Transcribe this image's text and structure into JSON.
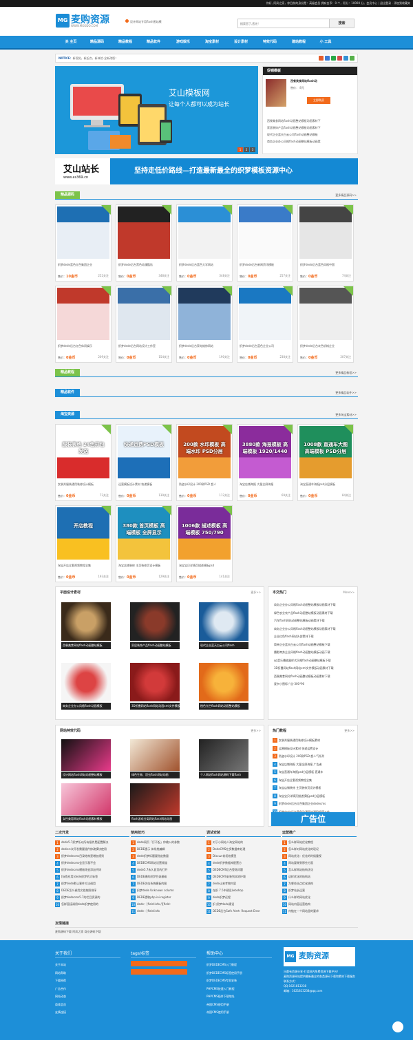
{
  "topbar": {
    "text": "你好, 阿凤之家，你目前的身份是：高级会员 拥有金币：0 个，积分：10000 分。会员中心 | 退出登录 · 添加到收藏夹"
  },
  "header": {
    "logo_mark": "MG",
    "logo_name": "麦购资源",
    "logo_url": "WWW.MGODO.COM",
    "slogan": "设计网站专用flash图站模",
    "search_placeholder": "搜索您了,您先!",
    "search_button": "搜索"
  },
  "nav": [
    "关 主页",
    "精品源码",
    "精品教程",
    "精品软件",
    "游戏娱乐",
    "淘宝素材",
    "设计素材",
    "特效代码",
    "建站教程",
    "小 工具"
  ],
  "notice": {
    "label": "NOTICE：",
    "text": "新视觉，新起点，新体验-全新改版！"
  },
  "banner": {
    "title": "艾山模板网",
    "subtitle": "让每个人都可以成为站长",
    "slides": [
      "1",
      "2",
      "3"
    ]
  },
  "promo": {
    "header": "促销模板",
    "title": "西餐美食网站flash动",
    "price": "售价：  8元",
    "buy": "立即购买",
    "items": [
      "西餐美食网站flash动画整站模板动画素材下",
      "家居装饰产品flash动画整站模板动画素材下",
      "现代企业蓝天白云公司flash动画整站模板",
      "商务企业办公风格flash动画整站模板动画素"
    ]
  },
  "ad": {
    "name": "艾山站长",
    "url": "www.as369.cn",
    "slogan": "坚持走低价路线—打造最新最全的织梦模板资源中心"
  },
  "sections": {
    "source": {
      "tag": "精品源码",
      "more": "更多精品源码>>"
    },
    "tutorial": {
      "tag": "精品教程",
      "more": "更多精品教程>>"
    },
    "software": {
      "tag": "精品软件",
      "more": "更多精品软件>>"
    },
    "taobao": {
      "tag": "淘宝资源",
      "more": "更多淘宝素材>>"
    }
  },
  "source_cards": [
    {
      "cap": "织梦dede蓝色红色集团企业",
      "price": "10金币",
      "fo": "252关注"
    },
    {
      "cap": "织梦dede后台黑色动漫酷炫",
      "price": "0金币",
      "fo": "348关注"
    },
    {
      "cap": "织梦dede后台蓝色大学网站",
      "price": "0金币",
      "fo": "348关注"
    },
    {
      "cap": "织梦dede后台新闻资讯模板",
      "price": "0金币",
      "fo": "257关注"
    },
    {
      "cap": "织梦dede后台蓝色风格中国",
      "price": "0金币",
      "fo": "74关注"
    },
    {
      "cap": "织梦dede后台红色休闲娱乐",
      "price": "0金币",
      "fo": "209关注"
    },
    {
      "cap": "织梦dede后台网站设计工作室",
      "price": "0金币",
      "fo": "154关注"
    },
    {
      "cap": "织梦dede后台家电维修网站",
      "price": "0金币",
      "fo": "190关注"
    },
    {
      "cap": "织梦dede后台蓝色企业公司",
      "price": "0金币",
      "fo": "238关注"
    },
    {
      "cap": "织梦dede后台灰色机械企业",
      "price": "0金币",
      "fo": "207关注"
    }
  ],
  "taobao_cards": [
    {
      "cap": "女装秀服装通用装修设计模板",
      "price": "0金币",
      "fo": "72关注",
      "label": "服装表格 24色打包发送"
    },
    {
      "cap": "运营模板设计素材 快递模板",
      "price": "0金币",
      "fo": "139关注",
      "label": "快递运费PSD模板"
    },
    {
      "cap": "防盗水印设计 200款PSD 超人",
      "price": "0金币",
      "fo": "112关注",
      "label": "200款 水印模板 高端水印 PSD分层"
    },
    {
      "cap": "淘宝店铺海报 大量全屏海报",
      "price": "0金币",
      "fo": "69关注",
      "label": "3880款 海报模板 高端模板 1920/1440"
    },
    {
      "cap": "淘宝直通车海报psd分层模板",
      "price": "0金币",
      "fo": "84关注",
      "label": "1008款 直通车大图 高端模板 PSD分层"
    },
    {
      "cap": "淘宝开店全套视频教程全集",
      "price": "0金币",
      "fo": "193关注",
      "label": "开店教程"
    },
    {
      "cap": "淘宝店铺装修 主页装修页设计模板",
      "price": "0金币",
      "fo": "129关注",
      "label": "380款 首页模板 高端模板 全屏显示"
    },
    {
      "cap": "淘宝宝贝详情页描述模板psd",
      "price": "0金币",
      "fo": "141关注",
      "label": "1006款 描述模板 高端模板 750/790"
    }
  ],
  "design_box": {
    "title": "平面设计素材",
    "more": "更多>>",
    "items": [
      "西餐美食网站flash动画整站模板",
      "家居装饰产品flash动画整站模板",
      "现代企业蓝天白云公司flash",
      "商务企业办公风格flash动画模板",
      "3D折叠网站flash网站动画xml文件模板",
      "橙色光芒flash网站动画整站模板"
    ]
  },
  "hot_box": {
    "title": "本交热门",
    "more": "More>>",
    "items": [
      "商务企业办公风格flash动画整站模板动画素材下载",
      "绿色农业农产品flash动画整站模板动画素材下载",
      "汽车flash网站动画整站模板动画素材下载",
      "商务企业办公风格flash动画整站模板动画素材下载",
      "企业红色flash网站头部素材下载",
      "简单企业蓝天白云公司flash动画整站模板下载",
      "播影商务企业风格flash动画整站模板动画下载",
      "qq音乐播放器样式风格flash动画整站模板下载",
      "3D折叠网站flash网站xml文件模板动画素材下载",
      "西餐美食网站flash动画整站模板动画素材下载",
      "复杂小图标广告-300*90"
    ]
  },
  "effects_box": {
    "title": "网站特效代码",
    "more": "更多>>",
    "items": [
      "设计网站flash网站动画整站模板",
      "绿色生物、昆虫flash网站动画",
      "个人网站flash网站源码下载flash",
      "女性美容网站flash动画素材模板",
      "flash游戏分类网站flash网站动画"
    ]
  },
  "hot_tutorial": {
    "title": "热门教程",
    "more": "更多>>",
    "items": [
      "女装秀服装通用装修设计模板素材",
      "运营模板设计素材 快递运费设计",
      "防盗水印设计 200款PSD 超人气系列",
      "淘宝店铺海报 大量全屏海报 广告者",
      "淘宝直通车海报psd分层模板 直通车",
      "淘宝开店全套视频教程全集",
      "淘宝店铺装修 主页装修页设计模板",
      "淘宝宝贝详情页描述模板psd分层模板",
      "织梦dede后台红色集团企业dedecms",
      "织梦dede后台黑色动漫网站源码程序工作"
    ],
    "ad_text": "广告位"
  },
  "columns": [
    {
      "title": "二次开发",
      "items": [
        "dede5.7织梦所以所有插件是配置解决",
        "dede二次开发需要插件修改模块使用",
        "织梦dedecms目录结构是增加规则",
        "织梦dedecms会显示我不会",
        "织梦dedecms模板改变添加代码",
        "[标签应用]dede织梦的大标签",
        "织梦dede默认事件方法调用",
        "DEDE怎么调用文档按照排序",
        "织梦dedecms5.7的栏目资源的",
        "怎样直接调用dede织梦使用的"
      ]
    },
    {
      "title": "使用技巧",
      "items": [
        "dede网页「打不起」你输入的参数",
        "DEDE提示 体系统编辑",
        "dede织梦标题要指定数量",
        "DEDECMS网站设置频道",
        "dede5.7永久首页的打开",
        "DEDE建的织梦目录基础",
        "DEDE仿站系统模板的图",
        "织梦dede Unknown column",
        "DEDE提取php.ini register",
        "dede：[field:info /][field:",
        "dede : [field:info"
      ]
    },
    {
      "title": "调试安装",
      "items": [
        "对于小网站人淘宝网站的",
        "DedeCMS在多数据库处理",
        "Discuz 较初始模型",
        "dede织梦数据库配置方",
        "DEDECMS后台登陆问题",
        "DEDECMS安装到本地环境",
        "dede让来考物内容",
        "在织 7.5中建设Lebshop",
        "dede织梦远程",
        "织 织梦dede建设",
        "DEDE后台Safe Alert: Request Error"
      ]
    },
    {
      "title": "运营推广",
      "items": [
        "怎么样网站优化教程",
        "怎么样对网站优化的现况",
        "网站优化：优化的时候重视",
        "网站要做到那些方面",
        "怎么样网站结构优化",
        "这样优化的结构站",
        "为哪些站点优化结构",
        "织梦站长运营",
        "什么样的网站优化",
        "网站内容运营结构",
        "内链在一个网站里的要求"
      ]
    }
  ],
  "links": {
    "title": "友情链接",
    "items": "麦购源码下载  阿凤之家  商业源码下载"
  },
  "footer": {
    "about": {
      "title": "关于我们",
      "items": [
        "关于本站",
        "网站帮助",
        "下载网帮",
        "广告合作",
        "网站动态",
        "商续会员",
        "友情连接"
      ]
    },
    "tags": {
      "title": "tags/标签"
    },
    "help": {
      "title": "帮助中心",
      "items": [
        "织梦DEDECMS入门教程",
        "织梦DEDECMS标签使用手册",
        "织梦DEDECMS专家安装",
        "PHPCMS快速入门教程",
        "PHPCMS插件下载地址",
        "帝国CMS使用手册",
        "帝国CMS使用手册"
      ]
    },
    "logo_mark": "MG",
    "logo_name": "麦购资源",
    "info": [
      "乐都有资源分享-打造网内免费资源下载平台！",
      "麦购资源网站提供最新最全的各类源码下载和素材下载服务",
      "联系方式：",
      "QQ:1621813238",
      "邮箱：1621813238@qq.com"
    ]
  },
  "colors": {
    "blue": "#1d8fd8",
    "orange": "#f26a1b",
    "green": "#7cc34a"
  }
}
